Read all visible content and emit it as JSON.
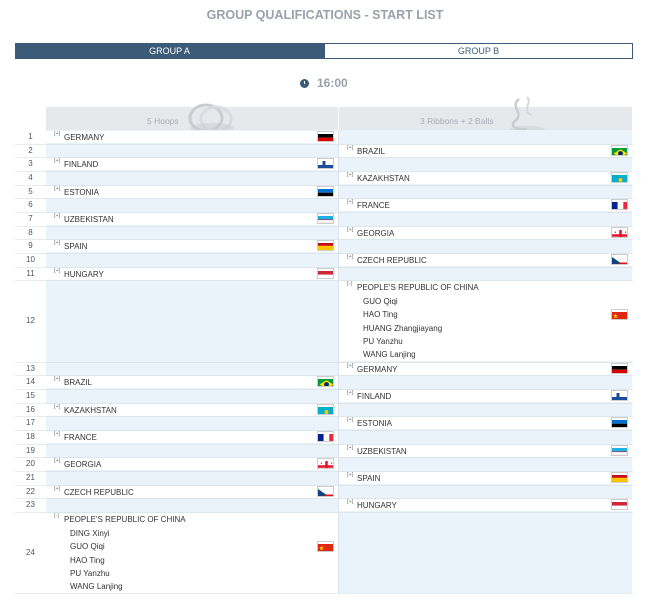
{
  "page_title": "GROUP QUALIFICATIONS - START LIST",
  "tabs": [
    {
      "label": "GROUP A",
      "active": true
    },
    {
      "label": "GROUP B",
      "active": false
    }
  ],
  "time": "16:00",
  "apparatus_a": "5 Hoops",
  "apparatus_b": "3 Ribbons + 2 Balls",
  "row_numbers": [
    "1",
    "2",
    "3",
    "4",
    "5",
    "6",
    "7",
    "8",
    "9",
    "10",
    "11",
    "12",
    "13",
    "14",
    "15",
    "16",
    "17",
    "18",
    "19",
    "20",
    "21",
    "22",
    "23",
    "24"
  ],
  "toggle_plus": "[+]",
  "toggle_minus": "[-]",
  "col_a": [
    {
      "team": "GERMANY",
      "flag": "GER"
    },
    {
      "team": "FINLAND",
      "flag": "FIN"
    },
    {
      "team": "ESTONIA",
      "flag": "EST"
    },
    {
      "team": "UZBEKISTAN",
      "flag": "UZB"
    },
    {
      "team": "SPAIN",
      "flag": "ESP"
    },
    {
      "team": "HUNGARY",
      "flag": "HUN"
    },
    {
      "team": "BRAZIL",
      "flag": "BRA"
    },
    {
      "team": "KAZAKHSTAN",
      "flag": "KAZ"
    },
    {
      "team": "FRANCE",
      "flag": "FRA"
    },
    {
      "team": "GEORGIA",
      "flag": "GEO"
    },
    {
      "team": "CZECH REPUBLIC",
      "flag": "CZE"
    },
    {
      "team": "PEOPLE'S REPUBLIC OF CHINA",
      "flag": "CHN",
      "gymnasts": [
        "DING Xinyi",
        "GUO Qiqi",
        "HAO Ting",
        "PU Yanzhu",
        "WANG Lanjing"
      ]
    }
  ],
  "col_b": [
    {
      "team": "BRAZIL",
      "flag": "BRA"
    },
    {
      "team": "KAZAKHSTAN",
      "flag": "KAZ"
    },
    {
      "team": "FRANCE",
      "flag": "FRA"
    },
    {
      "team": "GEORGIA",
      "flag": "GEO"
    },
    {
      "team": "CZECH REPUBLIC",
      "flag": "CZE"
    },
    {
      "team": "PEOPLE'S REPUBLIC OF CHINA",
      "flag": "CHN",
      "gymnasts": [
        "GUO Qiqi",
        "HAO Ting",
        "HUANG Zhangjiayang",
        "PU Yanzhu",
        "WANG Lanjing"
      ]
    },
    {
      "team": "GERMANY",
      "flag": "GER"
    },
    {
      "team": "FINLAND",
      "flag": "FIN"
    },
    {
      "team": "ESTONIA",
      "flag": "EST"
    },
    {
      "team": "UZBEKISTAN",
      "flag": "UZB"
    },
    {
      "team": "SPAIN",
      "flag": "ESP"
    },
    {
      "team": "HUNGARY",
      "flag": "HUN"
    }
  ]
}
